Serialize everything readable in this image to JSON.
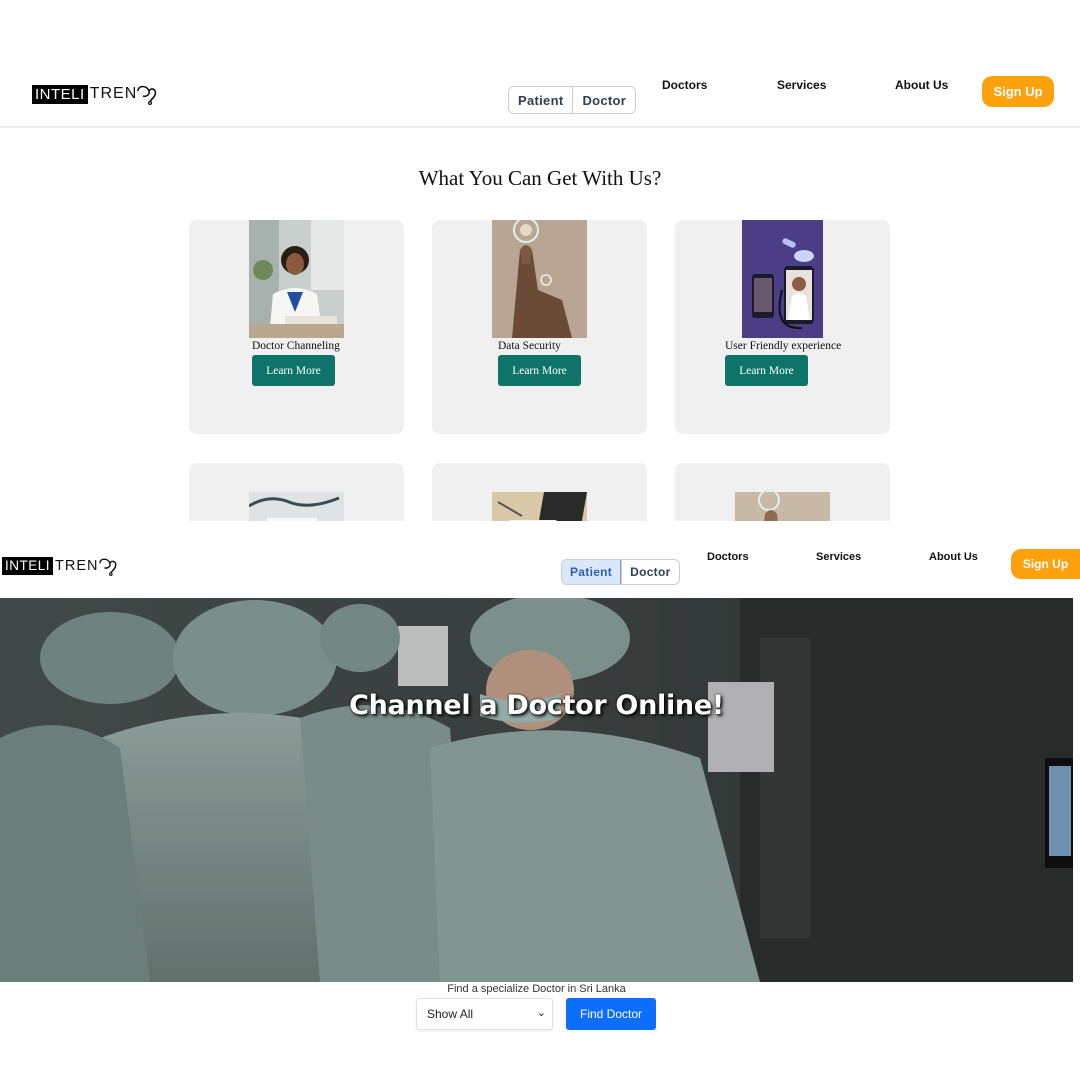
{
  "top_screen": {
    "logo": {
      "box_text": "INTELI",
      "rest_text": "TREN"
    },
    "user_toggle": {
      "patient_label": "Patient",
      "doctor_label": "Doctor"
    },
    "nav": {
      "doctors": "Doctors",
      "services": "Services",
      "about": "About Us"
    },
    "signup_label": "Sign Up",
    "section_title": "What You Can Get With Us?",
    "cards": [
      {
        "caption": "Doctor Channeling",
        "button": "Learn More"
      },
      {
        "caption": "Data Security",
        "button": "Learn More"
      },
      {
        "caption": "User Friendly experience",
        "button": "Learn More"
      }
    ]
  },
  "bottom_screen": {
    "logo": {
      "box_text": "INTELI",
      "rest_text": "TREN"
    },
    "user_toggle": {
      "patient_label": "Patient",
      "doctor_label": "Doctor",
      "selected": "Patient"
    },
    "nav": {
      "doctors": "Doctors",
      "services": "Services",
      "about": "About Us"
    },
    "signup_label": "Sign Up",
    "hero_title": "Channel a Doctor Online!",
    "find": {
      "label": "Find a specialize Doctor in Sri Lanka",
      "select_value": "Show All",
      "button": "Find Doctor"
    }
  },
  "colors": {
    "accent_orange": "#fda10d",
    "learn_more_teal": "#0e7368",
    "find_button_blue": "#0d6efd",
    "card_bg": "#f0f0f0"
  }
}
